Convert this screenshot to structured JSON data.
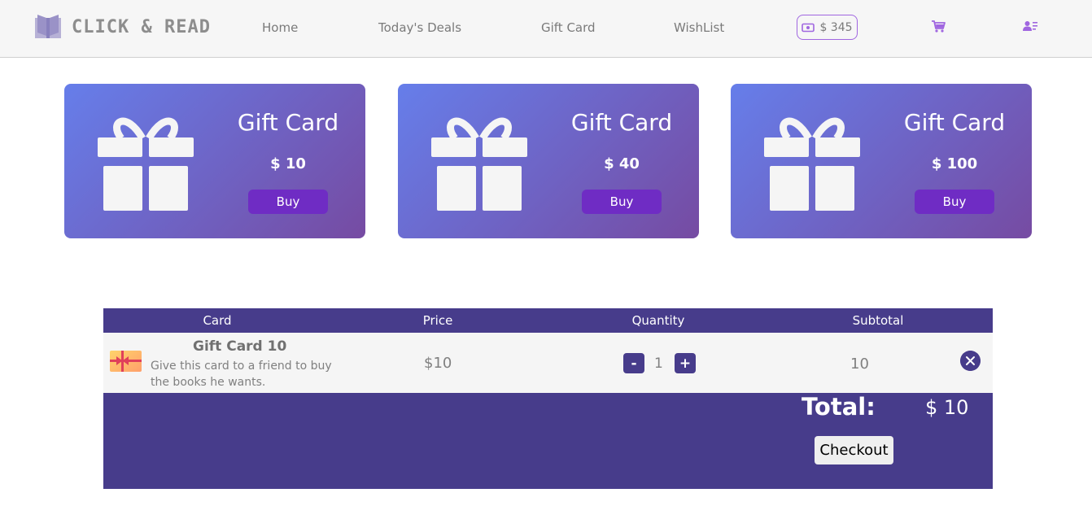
{
  "header": {
    "brand": "CLICK & READ",
    "nav": [
      {
        "label": "Home"
      },
      {
        "label": "Today's Deals"
      },
      {
        "label": "Gift Card"
      },
      {
        "label": "WishList"
      }
    ],
    "balance": "$ 345"
  },
  "gift_cards": [
    {
      "title": "Gift Card",
      "price": "$ 10",
      "buy_label": "Buy"
    },
    {
      "title": "Gift Card",
      "price": "$ 40",
      "buy_label": "Buy"
    },
    {
      "title": "Gift Card",
      "price": "$ 100",
      "buy_label": "Buy"
    }
  ],
  "cart": {
    "columns": [
      "Card",
      "Price",
      "Quantity",
      "Subtotal"
    ],
    "items": [
      {
        "title": "Gift Card 10",
        "description": "Give this card to a friend to buy the books he wants.",
        "price": "$10",
        "quantity": "1",
        "minus": "-",
        "plus": "+",
        "subtotal": "10"
      }
    ],
    "total_label": "Total:",
    "total_value": "$ 10",
    "checkout_label": "Checkout"
  },
  "colors": {
    "accent": "#473c8b",
    "buy_button": "#6f2cc4",
    "card_gradient_start": "#667eea",
    "card_gradient_end": "#764ba2",
    "icon_purple": "#a066e0"
  },
  "icons": {
    "logo": "book-icon",
    "balance": "money-icon",
    "cart": "cart-icon",
    "user": "user-card-icon",
    "gift": "gift-icon",
    "remove": "close-icon"
  }
}
